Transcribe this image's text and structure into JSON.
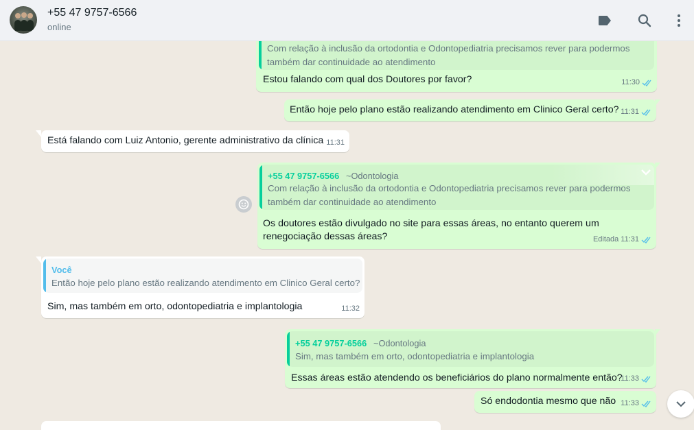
{
  "header": {
    "contact_name": "+55 47 9757-6566",
    "status": "online",
    "icons": [
      "label-icon",
      "search-icon",
      "menu-icon"
    ]
  },
  "messages": [
    {
      "direction": "outgoing",
      "quote": {
        "text_line1": "Com relação à inclusão da ortodontia e Odontopediatria precisamos rever para podermos",
        "text_line2": "também dar continuidade ao atendimento"
      },
      "text": "Estou falando com qual dos Doutores por favor?",
      "time": "11:30"
    },
    {
      "direction": "outgoing",
      "text": "Então hoje pelo plano estão realizando atendimento em Clinico Geral certo?",
      "time": "11:31"
    },
    {
      "direction": "incoming",
      "text": "Está falando com Luiz Antonio, gerente administrativo da clínica",
      "time": "11:31"
    },
    {
      "direction": "outgoing",
      "quote": {
        "author": "+55 47 9757-6566",
        "group": "~Odontologia",
        "text_line1": "Com relação à inclusão da ortodontia e Odontopediatria precisamos rever para podermos",
        "text_line2": "também dar continuidade ao atendimento"
      },
      "text_line1": "Os doutores estão divulgado no site para essas áreas, no entanto querem um",
      "text_line2": "renegociação dessas áreas?",
      "edited": "Editada",
      "time": "11:31"
    },
    {
      "direction": "incoming",
      "quote": {
        "author": "Você",
        "text_line1": "Então hoje pelo plano estão realizando atendimento em Clinico Geral certo?"
      },
      "text": "Sim, mas também em orto, odontopediatria e implantologia",
      "time": "11:32"
    },
    {
      "direction": "outgoing",
      "quote": {
        "author": "+55 47 9757-6566",
        "group": "~Odontologia",
        "text_line1": "Sim, mas também em orto, odontopediatria e implantologia"
      },
      "text": "Essas áreas estão atendendo os beneficiários do plano normalmente então?",
      "time": "11:33"
    },
    {
      "direction": "outgoing",
      "text": "Só endodontia mesmo que não",
      "time": "11:33"
    }
  ],
  "colors": {
    "outgoing_bubble": "#d9fdd3",
    "incoming_bubble": "#ffffff",
    "quote_bar_outgoing": "#06cf9c",
    "quote_bar_incoming": "#53bdeb",
    "read_ticks": "#53bdeb",
    "chat_background": "#efeae2"
  }
}
